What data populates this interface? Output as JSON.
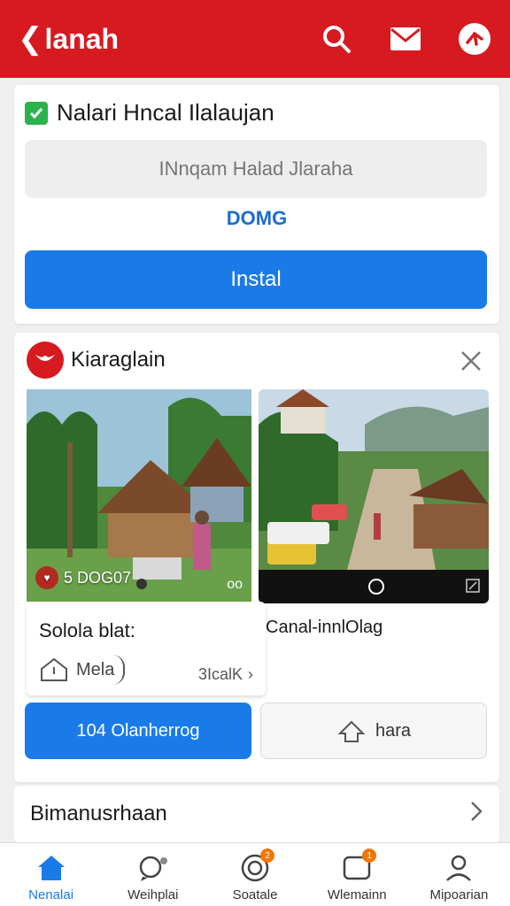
{
  "header": {
    "title": "lanah",
    "bg": "#d71920"
  },
  "form_card": {
    "heading": "Nalari Hncal Ilalaujan",
    "input_placeholder": "INnqam Halad Jlaraha",
    "link": "DOMG",
    "primary_button": "Instal"
  },
  "promo_card": {
    "source_name": "Kiaraglain",
    "items": [
      {
        "overlay_text": "5 DOG07",
        "overlay_right": "oo",
        "title": "Solola blat:",
        "meta_label": "Mela",
        "meta_right": "3IcalK"
      },
      {
        "title": "Canal-innlOlag"
      }
    ],
    "primary_button": "104 Olanherrog",
    "secondary_button": "hara"
  },
  "list_row": {
    "label": "Bimanusrhaan"
  },
  "bottom_nav": [
    {
      "label": "Nenalai",
      "icon": "home-icon",
      "active": true
    },
    {
      "label": "Weihplai",
      "icon": "chat-icon",
      "active": false
    },
    {
      "label": "Soatale",
      "icon": "target-icon",
      "active": false,
      "badge": "2"
    },
    {
      "label": "Wlemainn",
      "icon": "message-icon",
      "active": false,
      "badge": "1"
    },
    {
      "label": "Mipoarian",
      "icon": "profile-icon",
      "active": false
    }
  ],
  "colors": {
    "accent": "#1a7be8",
    "brand": "#d71920",
    "success": "#2bb24c"
  }
}
